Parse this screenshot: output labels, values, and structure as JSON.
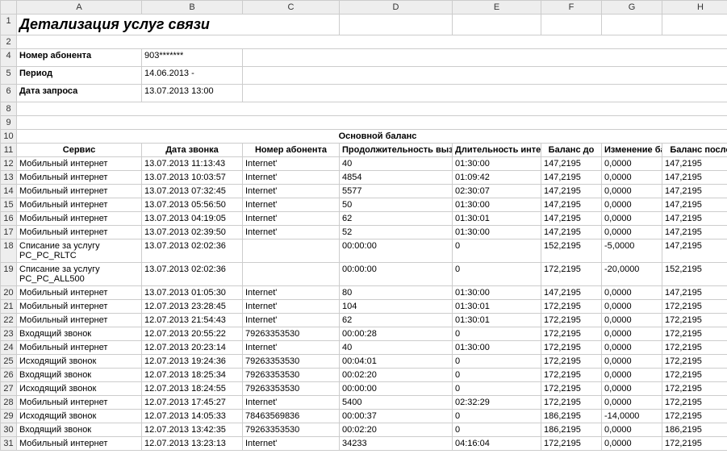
{
  "col_letters": [
    "A",
    "B",
    "C",
    "D",
    "E",
    "F",
    "G",
    "H"
  ],
  "title": "Детализация услуг связи",
  "meta": {
    "subscriber_label": "Номер абонента",
    "subscriber_value": "903*******",
    "period_label": "Период",
    "period_value": "14.06.2013 -",
    "request_label": "Дата запроса",
    "request_value": "13.07.2013 13:00"
  },
  "section_title": "Основной баланс",
  "headers": [
    "Сервис",
    "Дата звонка",
    "Номер абонента",
    "Продолжительность вызова\\Объем переданных данных",
    "Длительность интернет сессии",
    "Баланс до",
    "Изменение баланса",
    "Баланс после"
  ],
  "rows": [
    {
      "n": 12,
      "c": [
        "Мобильный интернет",
        "13.07.2013 11:13:43",
        "Internet'",
        "40",
        "01:30:00",
        "147,2195",
        "0,0000",
        "147,2195"
      ]
    },
    {
      "n": 13,
      "c": [
        "Мобильный интернет",
        "13.07.2013 10:03:57",
        "Internet'",
        "4854",
        "01:09:42",
        "147,2195",
        "0,0000",
        "147,2195"
      ]
    },
    {
      "n": 14,
      "c": [
        "Мобильный интернет",
        "13.07.2013 07:32:45",
        "Internet'",
        "5577",
        "02:30:07",
        "147,2195",
        "0,0000",
        "147,2195"
      ]
    },
    {
      "n": 15,
      "c": [
        "Мобильный интернет",
        "13.07.2013 05:56:50",
        "Internet'",
        "50",
        "01:30:00",
        "147,2195",
        "0,0000",
        "147,2195"
      ]
    },
    {
      "n": 16,
      "c": [
        "Мобильный интернет",
        "13.07.2013 04:19:05",
        "Internet'",
        "62",
        "01:30:01",
        "147,2195",
        "0,0000",
        "147,2195"
      ]
    },
    {
      "n": 17,
      "c": [
        "Мобильный интернет",
        "13.07.2013 02:39:50",
        "Internet'",
        "52",
        "01:30:00",
        "147,2195",
        "0,0000",
        "147,2195"
      ]
    },
    {
      "n": 18,
      "c": [
        "Списание за услугу PC_PC_RLTC",
        "13.07.2013 02:02:36",
        "",
        "00:00:00",
        "0",
        "152,2195",
        "-5,0000",
        "147,2195"
      ]
    },
    {
      "n": 19,
      "c": [
        "Списание за услугу PC_PC_ALL500",
        "13.07.2013 02:02:36",
        "",
        "00:00:00",
        "0",
        "172,2195",
        "-20,0000",
        "152,2195"
      ]
    },
    {
      "n": 20,
      "c": [
        "Мобильный интернет",
        "13.07.2013 01:05:30",
        "Internet'",
        "80",
        "01:30:00",
        "147,2195",
        "0,0000",
        "147,2195"
      ]
    },
    {
      "n": 21,
      "c": [
        "Мобильный интернет",
        "12.07.2013 23:28:45",
        "Internet'",
        "104",
        "01:30:01",
        "172,2195",
        "0,0000",
        "172,2195"
      ]
    },
    {
      "n": 22,
      "c": [
        "Мобильный интернет",
        "12.07.2013 21:54:43",
        "Internet'",
        "62",
        "01:30:01",
        "172,2195",
        "0,0000",
        "172,2195"
      ]
    },
    {
      "n": 23,
      "c": [
        "Входящий звонок",
        "12.07.2013 20:55:22",
        "79263353530",
        "00:00:28",
        "0",
        "172,2195",
        "0,0000",
        "172,2195"
      ]
    },
    {
      "n": 24,
      "c": [
        "Мобильный интернет",
        "12.07.2013 20:23:14",
        "Internet'",
        "40",
        "01:30:00",
        "172,2195",
        "0,0000",
        "172,2195"
      ]
    },
    {
      "n": 25,
      "c": [
        "Исходящий звонок",
        "12.07.2013 19:24:36",
        "79263353530",
        "00:04:01",
        "0",
        "172,2195",
        "0,0000",
        "172,2195"
      ]
    },
    {
      "n": 26,
      "c": [
        "Входящий звонок",
        "12.07.2013 18:25:34",
        "79263353530",
        "00:02:20",
        "0",
        "172,2195",
        "0,0000",
        "172,2195"
      ]
    },
    {
      "n": 27,
      "c": [
        "Исходящий звонок",
        "12.07.2013 18:24:55",
        "79263353530",
        "00:00:00",
        "0",
        "172,2195",
        "0,0000",
        "172,2195"
      ]
    },
    {
      "n": 28,
      "c": [
        "Мобильный интернет",
        "12.07.2013 17:45:27",
        "Internet'",
        "5400",
        "02:32:29",
        "172,2195",
        "0,0000",
        "172,2195"
      ]
    },
    {
      "n": 29,
      "c": [
        "Исходящий звонок",
        "12.07.2013 14:05:33",
        "78463569836",
        "00:00:37",
        "0",
        "186,2195",
        "-14,0000",
        "172,2195"
      ]
    },
    {
      "n": 30,
      "c": [
        "Входящий звонок",
        "12.07.2013 13:42:35",
        "79263353530",
        "00:02:20",
        "0",
        "186,2195",
        "0,0000",
        "186,2195"
      ]
    },
    {
      "n": 31,
      "c": [
        "Мобильный интернет",
        "12.07.2013 13:23:13",
        "Internet'",
        "34233",
        "04:16:04",
        "172,2195",
        "0,0000",
        "172,2195"
      ]
    }
  ]
}
